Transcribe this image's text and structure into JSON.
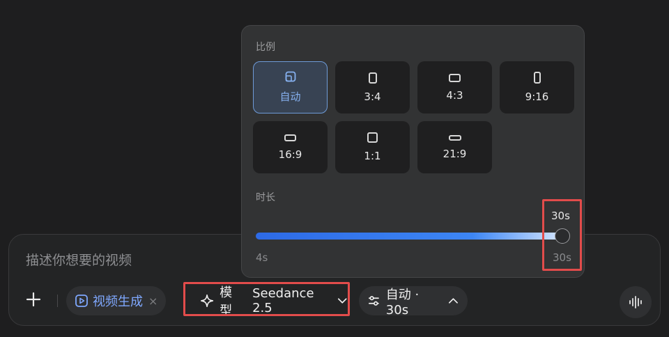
{
  "composer": {
    "placeholder": "描述你想要的视频",
    "video_chip_label": "视频生成",
    "video_chip_close": "×",
    "model_label": "模型",
    "model_value": "Seedance 2.5",
    "settings_label": "自动 · 30s"
  },
  "popup": {
    "ratio_label": "比例",
    "ratios": [
      "自动",
      "3:4",
      "4:3",
      "9:16",
      "16:9",
      "1:1",
      "21:9"
    ],
    "selected_ratio": "自动",
    "duration_label": "时长",
    "duration_value": "30s",
    "duration_min": "4s",
    "duration_max": "30s",
    "duration_fraction": 1.0
  },
  "colors": {
    "accent": "#3d86f4",
    "highlight": "#e24c4b",
    "selected_text": "#86b1f0"
  }
}
